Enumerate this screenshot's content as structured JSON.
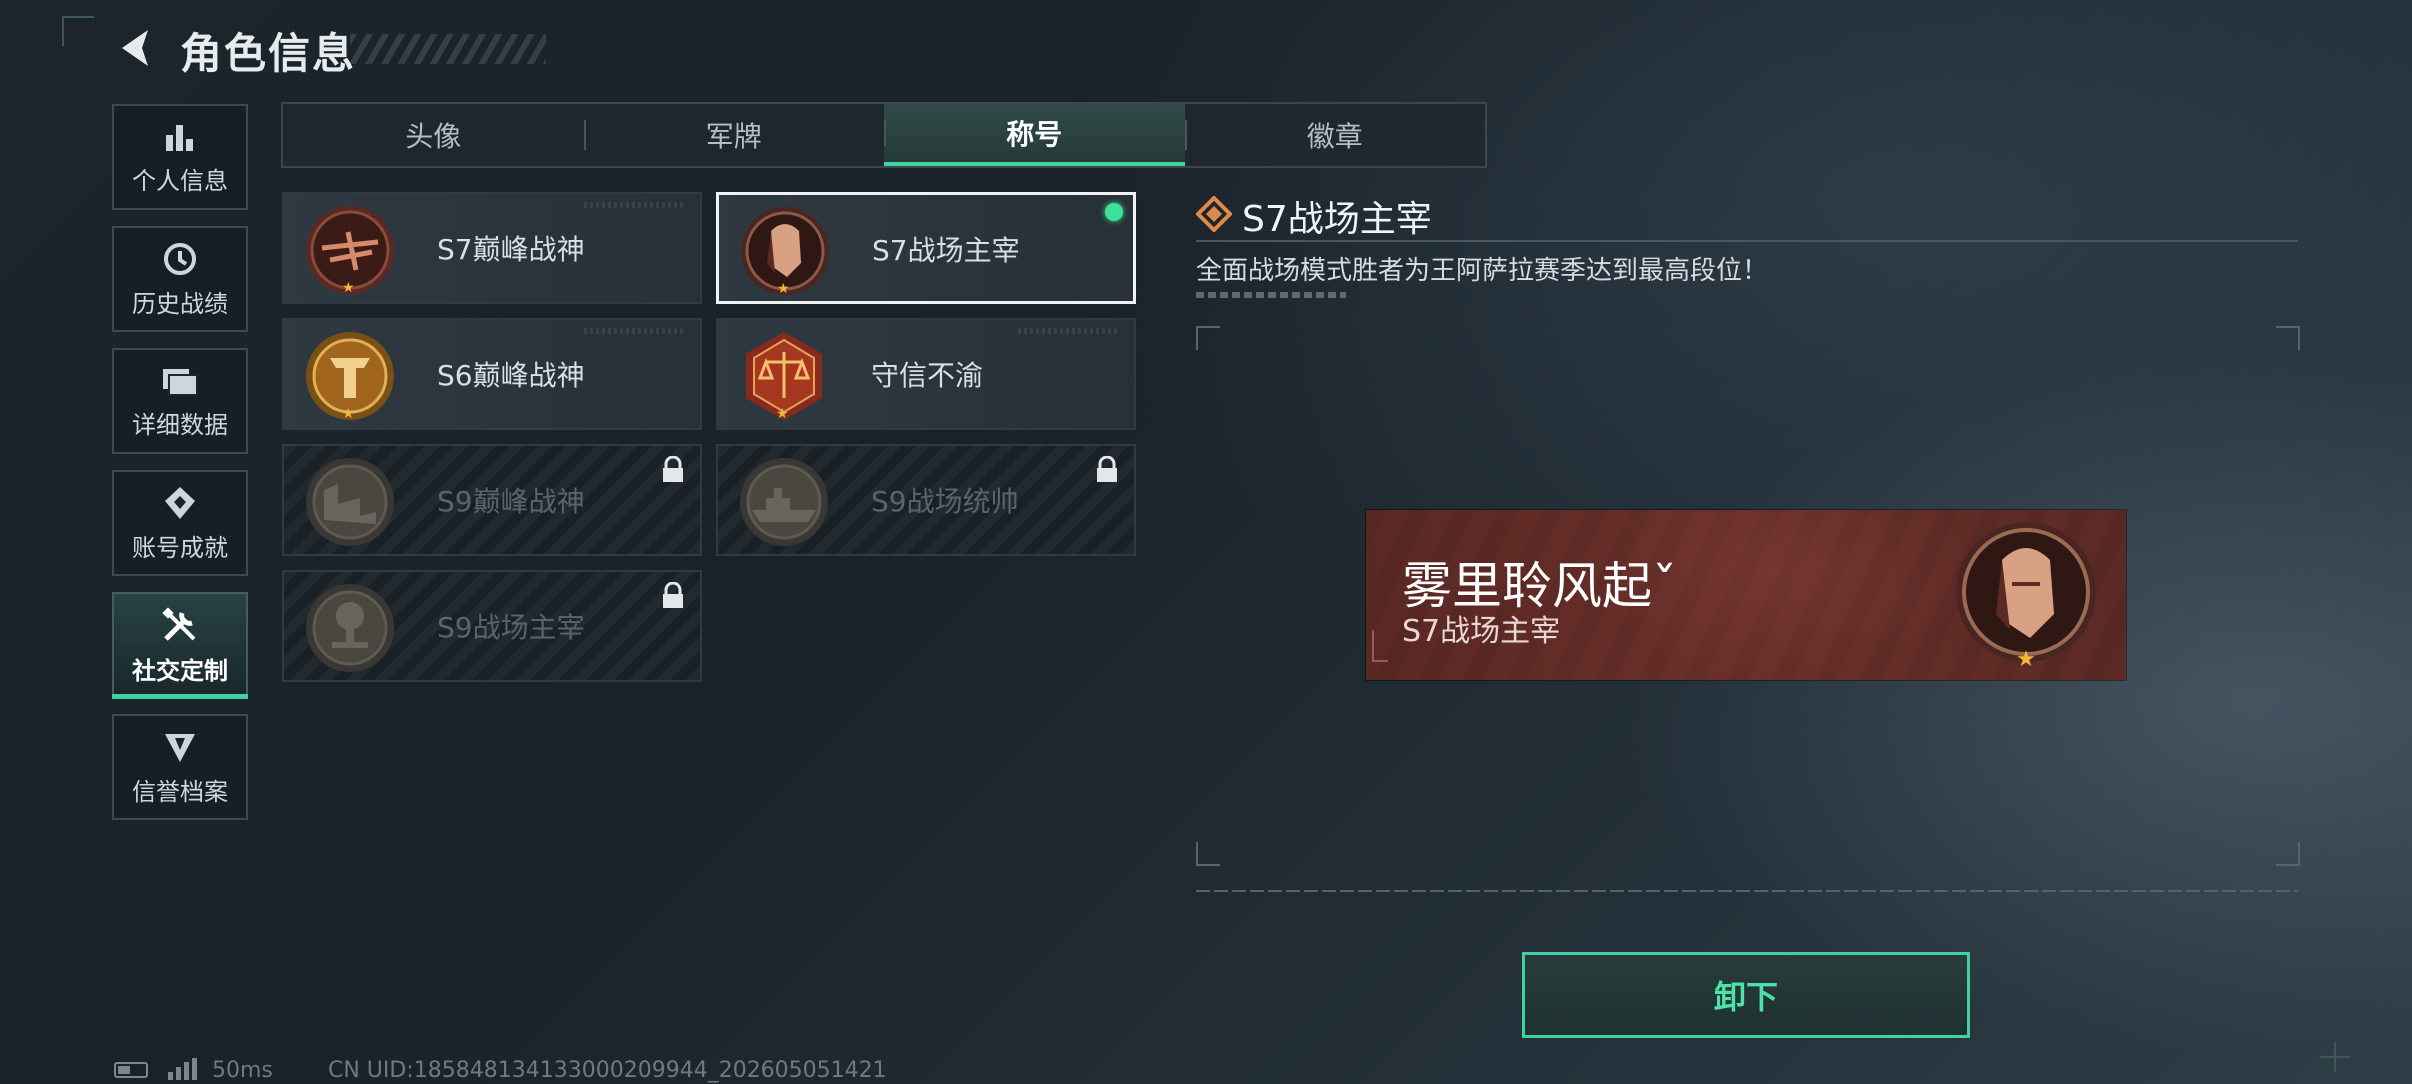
{
  "header": {
    "title": "角色信息"
  },
  "sidebar": {
    "items": [
      {
        "label": "个人信息",
        "icon": "bar-chart-icon"
      },
      {
        "label": "历史战绩",
        "icon": "history-clock-icon"
      },
      {
        "label": "详细数据",
        "icon": "folder-icon"
      },
      {
        "label": "账号成就",
        "icon": "achievement-icon"
      },
      {
        "label": "社交定制",
        "icon": "tools-icon",
        "active": true
      },
      {
        "label": "信誉档案",
        "icon": "shield-wings-icon"
      }
    ]
  },
  "tabs": [
    {
      "label": "头像"
    },
    {
      "label": "军牌"
    },
    {
      "label": "称号",
      "active": true
    },
    {
      "label": "徽章"
    }
  ],
  "titles": [
    {
      "name": "S7巅峰战神",
      "locked": false,
      "medal": "crossbow-medal-icon"
    },
    {
      "name": "S7战场主宰",
      "locked": false,
      "selected": true,
      "equipped": true,
      "medal": "warrior-head-medal-icon"
    },
    {
      "name": "S6巅峰战神",
      "locked": false,
      "medal": "t-emblem-medal-icon"
    },
    {
      "name": "守信不渝",
      "locked": false,
      "medal": "scales-medal-icon"
    },
    {
      "name": "S9巅峰战神",
      "locked": true,
      "medal": "fortress-medal-icon"
    },
    {
      "name": "S9战场统帅",
      "locked": true,
      "medal": "warship-medal-icon"
    },
    {
      "name": "S9战场主宰",
      "locked": true,
      "medal": "explosion-medal-icon"
    }
  ],
  "detail": {
    "title": "S7战场主宰",
    "description": "全面战场模式胜者为王阿萨拉赛季达到最高段位！",
    "preview": {
      "player_name": "雾里聆风起ˇ",
      "title": "S7战场主宰"
    },
    "action_label": "卸下"
  },
  "status": {
    "ping": "50ms",
    "uid": "CN UID:18584813413300020994​4_202605051421"
  },
  "colors": {
    "accent": "#3fd1a0",
    "equipped_dot": "#3fe09a",
    "nameplate": "#6a2f29",
    "star": "#f0b93a"
  }
}
